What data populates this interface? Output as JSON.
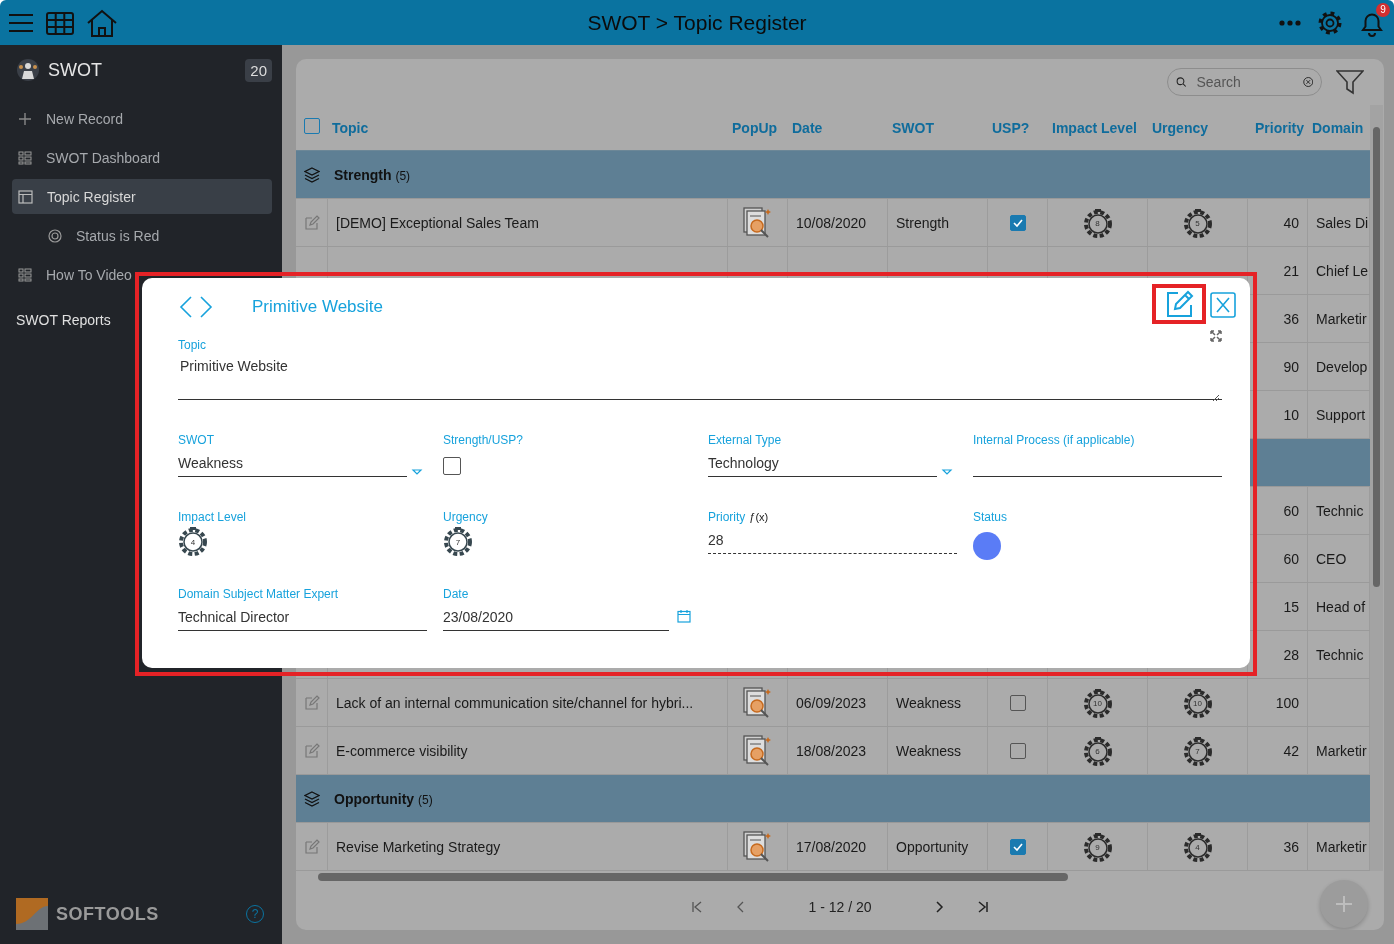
{
  "header": {
    "title": "SWOT > Topic Register",
    "notification_count": "9"
  },
  "sidebar": {
    "app_name": "SWOT",
    "record_count": "20",
    "items": [
      {
        "kind": "add",
        "label": "New Record",
        "selected": false
      },
      {
        "kind": "dashboard",
        "label": "SWOT Dashboard",
        "selected": false
      },
      {
        "kind": "register",
        "label": "Topic Register",
        "selected": true,
        "children": [
          {
            "kind": "filter",
            "label": "Status is Red",
            "selected": false
          }
        ]
      },
      {
        "kind": "dashboard",
        "label": "How To Video",
        "selected": false
      },
      {
        "kind": "heading",
        "label": "SWOT Reports",
        "selected": false
      }
    ],
    "brand": "SOFTOOLS",
    "help_label": "?"
  },
  "table": {
    "search": {
      "placeholder": "Search"
    },
    "select_all_checked": false,
    "columns": [
      "Topic",
      "PopUp",
      "Date",
      "SWOT",
      "USP?",
      "Impact Level",
      "Urgency",
      "Priority",
      "Domain"
    ],
    "rows": [
      {
        "kind": "group",
        "label": "Strength",
        "count": "(5)"
      },
      {
        "kind": "record",
        "topic": "[DEMO] Exceptional Sales Team",
        "date": "10/08/2020",
        "swot": "Strength",
        "usp": true,
        "impact": "8",
        "urgency": "5",
        "priority": "40",
        "domain": "Sales Di"
      },
      {
        "kind": "record",
        "priority": "21",
        "domain": "Chief Le"
      },
      {
        "kind": "record",
        "priority": "36",
        "domain": "Marketir"
      },
      {
        "kind": "record",
        "priority": "90",
        "domain": "Develop"
      },
      {
        "kind": "record",
        "priority": "10",
        "domain": "Support"
      },
      {
        "kind": "group"
      },
      {
        "kind": "record",
        "priority": "60",
        "domain": "Technic"
      },
      {
        "kind": "record",
        "priority": "60",
        "domain": "CEO"
      },
      {
        "kind": "record",
        "priority": "15",
        "domain": "Head of"
      },
      {
        "kind": "record",
        "priority": "28",
        "domain": "Technic"
      },
      {
        "kind": "record",
        "topic": "Lack of an internal communication site/channel for hybri...",
        "date": "06/09/2023",
        "swot": "Weakness",
        "usp": false,
        "impact": "10",
        "urgency": "10",
        "priority": "100"
      },
      {
        "kind": "record",
        "topic": "E-commerce visibility",
        "date": "18/08/2023",
        "swot": "Weakness",
        "usp": false,
        "impact": "6",
        "urgency": "7",
        "priority": "42",
        "domain": "Marketir"
      },
      {
        "kind": "group",
        "label": "Opportunity",
        "count": "(5)"
      },
      {
        "kind": "record",
        "topic": "Revise Marketing Strategy",
        "date": "17/08/2020",
        "swot": "Opportunity",
        "usp": true,
        "impact": "9",
        "urgency": "4",
        "priority": "36",
        "domain": "Marketir"
      }
    ],
    "pagination": "1 - 12 / 20"
  },
  "modal": {
    "title": "Primitive Website",
    "fields": [
      {
        "kind": "textarea",
        "label": "Topic",
        "value": "Primitive Website"
      },
      {
        "kind": "select",
        "label": "SWOT",
        "value": "Weakness"
      },
      {
        "kind": "checkbox",
        "label": "Strength/USP?",
        "checked": false
      },
      {
        "kind": "select",
        "label": "External Type",
        "value": "Technology"
      },
      {
        "kind": "text",
        "label": "Internal Process (if applicable)"
      },
      {
        "kind": "dial",
        "label": "Impact Level",
        "value": "4"
      },
      {
        "kind": "dial",
        "label": "Urgency",
        "value": "7"
      },
      {
        "kind": "formula",
        "label": "Priority",
        "mark": "ƒ(x)",
        "value": "28"
      },
      {
        "kind": "status",
        "label": "Status",
        "color": "#5a7cf6"
      },
      {
        "kind": "text",
        "label": "Domain Subject Matter Expert",
        "value": "Technical Director"
      },
      {
        "kind": "date",
        "label": "Date",
        "value": "23/08/2020"
      }
    ]
  }
}
